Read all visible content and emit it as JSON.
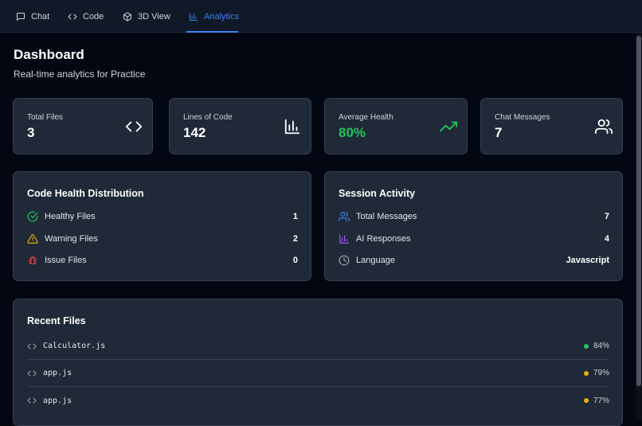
{
  "tabs": [
    {
      "label": "Chat",
      "icon": "chat-icon"
    },
    {
      "label": "Code",
      "icon": "code-icon"
    },
    {
      "label": "3D View",
      "icon": "cube-icon"
    },
    {
      "label": "Analytics",
      "icon": "bar-chart-icon",
      "active": true
    }
  ],
  "header": {
    "title": "Dashboard",
    "subtitle": "Real-time analytics for Practice"
  },
  "stats": [
    {
      "label": "Total Files",
      "value": "3",
      "icon": "code-icon"
    },
    {
      "label": "Lines of Code",
      "value": "142",
      "icon": "bar-chart-icon"
    },
    {
      "label": "Average Health",
      "value": "80%",
      "icon": "trending-up-icon",
      "color": "#22c55e"
    },
    {
      "label": "Chat Messages",
      "value": "7",
      "icon": "users-icon"
    }
  ],
  "health": {
    "title": "Code Health Distribution",
    "rows": [
      {
        "label": "Healthy Files",
        "value": "1",
        "icon": "check-circle-icon",
        "color": "#22c55e"
      },
      {
        "label": "Warning Files",
        "value": "2",
        "icon": "warning-triangle-icon",
        "color": "#eab308"
      },
      {
        "label": "Issue Files",
        "value": "0",
        "icon": "bug-icon",
        "color": "#ef4444"
      }
    ]
  },
  "session": {
    "title": "Session Activity",
    "rows": [
      {
        "label": "Total Messages",
        "value": "7",
        "icon": "users-icon",
        "color": "#3b82f6"
      },
      {
        "label": "AI Responses",
        "value": "4",
        "icon": "bar-chart-icon",
        "color": "#a855f7"
      },
      {
        "label": "Language",
        "value": "Javascript",
        "icon": "clock-icon",
        "color": "#9ca3af"
      }
    ]
  },
  "recent": {
    "title": "Recent Files",
    "files": [
      {
        "name": "Calculator.js",
        "health": "84%",
        "status_color": "#22c55e"
      },
      {
        "name": "app.js",
        "health": "79%",
        "status_color": "#eab308"
      },
      {
        "name": "app.js",
        "health": "77%",
        "status_color": "#eab308"
      }
    ]
  }
}
